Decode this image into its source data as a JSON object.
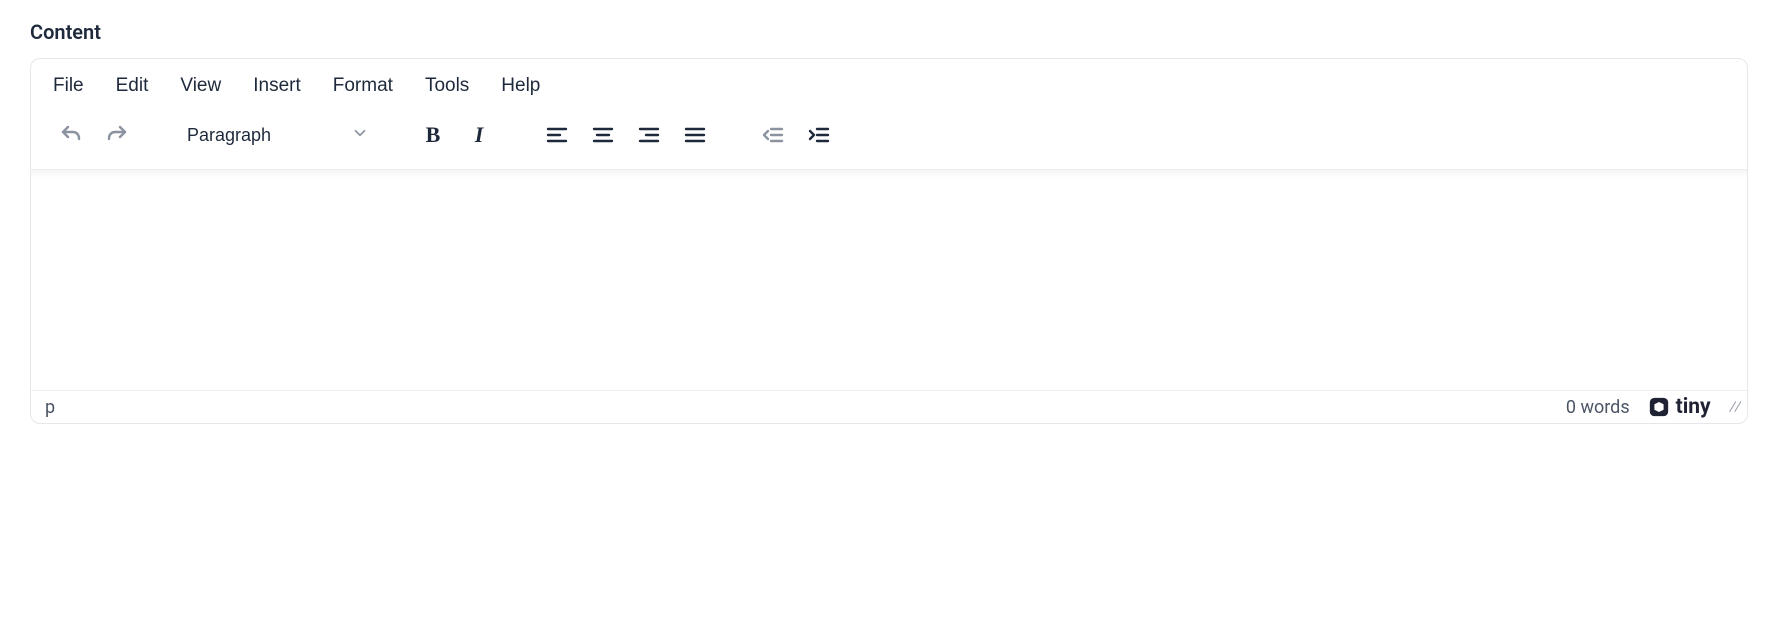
{
  "field": {
    "label": "Content"
  },
  "menubar": {
    "items": [
      {
        "label": "File"
      },
      {
        "label": "Edit"
      },
      {
        "label": "View"
      },
      {
        "label": "Insert"
      },
      {
        "label": "Format"
      },
      {
        "label": "Tools"
      },
      {
        "label": "Help"
      }
    ]
  },
  "toolbar": {
    "block_format": {
      "selected": "Paragraph"
    }
  },
  "status": {
    "path": "p",
    "wordcount": "0 words",
    "branding": "tiny"
  }
}
